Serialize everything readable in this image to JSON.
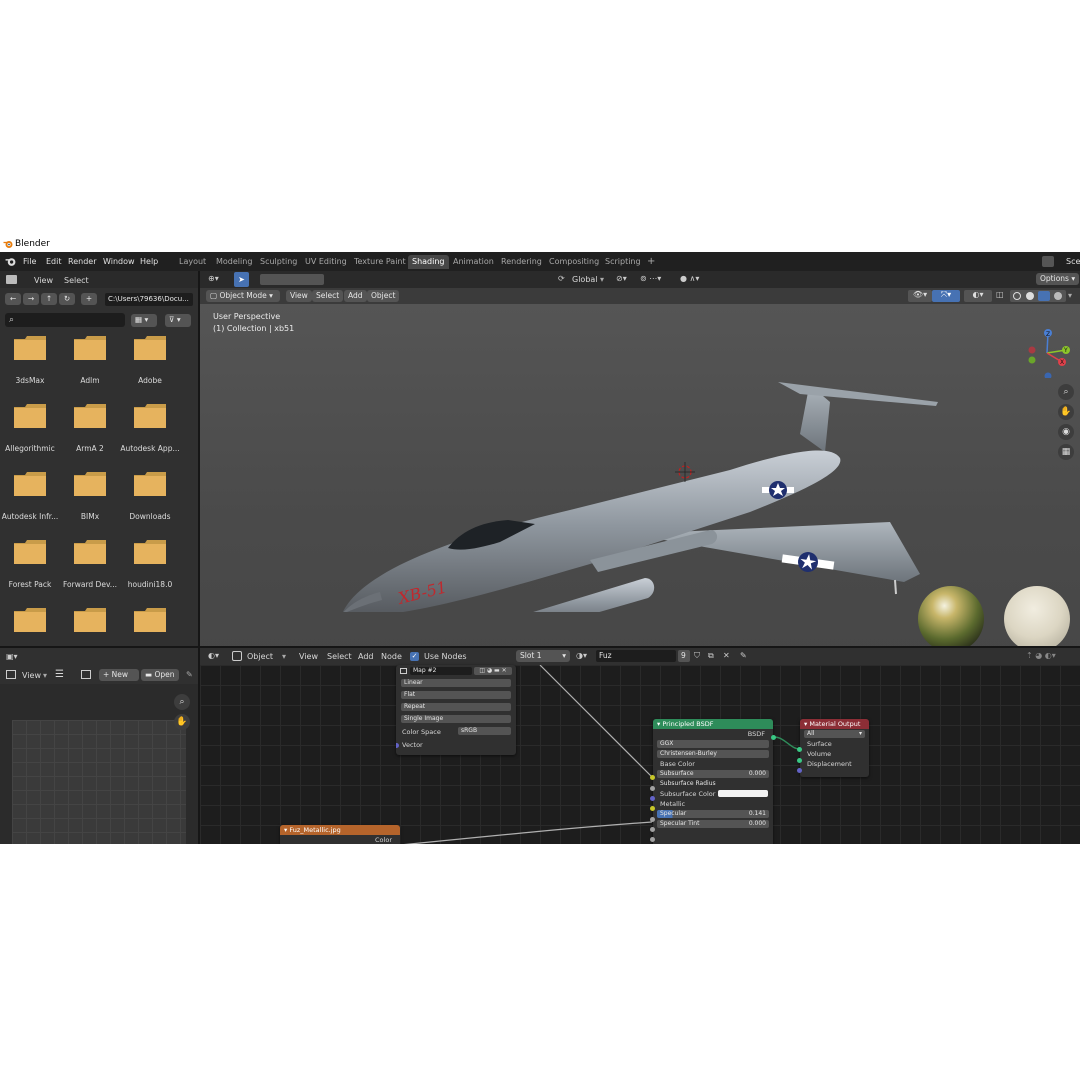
{
  "app": {
    "title": "Blender"
  },
  "menu": [
    "File",
    "Edit",
    "Render",
    "Window",
    "Help"
  ],
  "workspaces": [
    "Layout",
    "Modeling",
    "Sculpting",
    "UV Editing",
    "Texture Paint",
    "Shading",
    "Animation",
    "Rendering",
    "Compositing",
    "Scripting",
    "+"
  ],
  "active_workspace": "Shading",
  "scene_label": "Sce",
  "file_browser": {
    "menu": [
      "View",
      "Select"
    ],
    "path": "C:\\Users\\79636\\Docu...",
    "search_placeholder": "",
    "folders": [
      "3dsMax",
      "Adlm",
      "Adobe",
      "Allegorithmic",
      "ArmA 2",
      "Autodesk App...",
      "Autodesk Infr...",
      "BIMx",
      "Downloads",
      "Forest Pack",
      "Forward Dev...",
      "houdini18.0",
      "",
      "",
      ""
    ]
  },
  "viewport": {
    "mode": "Object Mode",
    "menu": [
      "View",
      "Select",
      "Add",
      "Object"
    ],
    "transform": "Global",
    "options": "Options",
    "perspective": "User Perspective",
    "collection": "(1) Collection | xb51",
    "aircraft_text": "XB-51",
    "axes": [
      "Z",
      "Y",
      "X"
    ]
  },
  "image_editor": {
    "view": "View",
    "new": "New",
    "open": "Open"
  },
  "node_editor": {
    "object": "Object",
    "menu": [
      "View",
      "Select",
      "Add",
      "Node"
    ],
    "use_nodes": "Use Nodes",
    "slot": "Slot 1",
    "material": "Fuz",
    "users": "9",
    "image_node": {
      "image": "Map #2",
      "rows": [
        "Linear",
        "Flat",
        "Repeat",
        "Single Image"
      ],
      "color_space_label": "Color Space",
      "color_space": "sRGB",
      "vector": "Vector"
    },
    "principled": {
      "title": "Principled BSDF",
      "bsdf": "BSDF",
      "dist": "GGX",
      "sss": "Christensen-Burley",
      "base_color": "Base Color",
      "subsurface": "Subsurface",
      "subsurface_val": "0.000",
      "subsurface_radius": "Subsurface Radius",
      "subsurface_color": "Subsurface Color",
      "metallic": "Metallic",
      "specular": "Specular",
      "specular_val": "0.141",
      "specular_tint": "Specular Tint",
      "specular_tint_val": "0.000"
    },
    "output": {
      "title": "Material Output",
      "target": "All",
      "surface": "Surface",
      "volume": "Volume",
      "displacement": "Displacement"
    },
    "metal_node": {
      "title": "Fuz_Metallic.jpg",
      "color": "Color"
    }
  },
  "colors": {
    "accent": "#4772b3",
    "node_green": "#2e8c5a",
    "node_red": "#8c2e36",
    "node_orange": "#b5642b",
    "folder": "#e6b35e"
  }
}
